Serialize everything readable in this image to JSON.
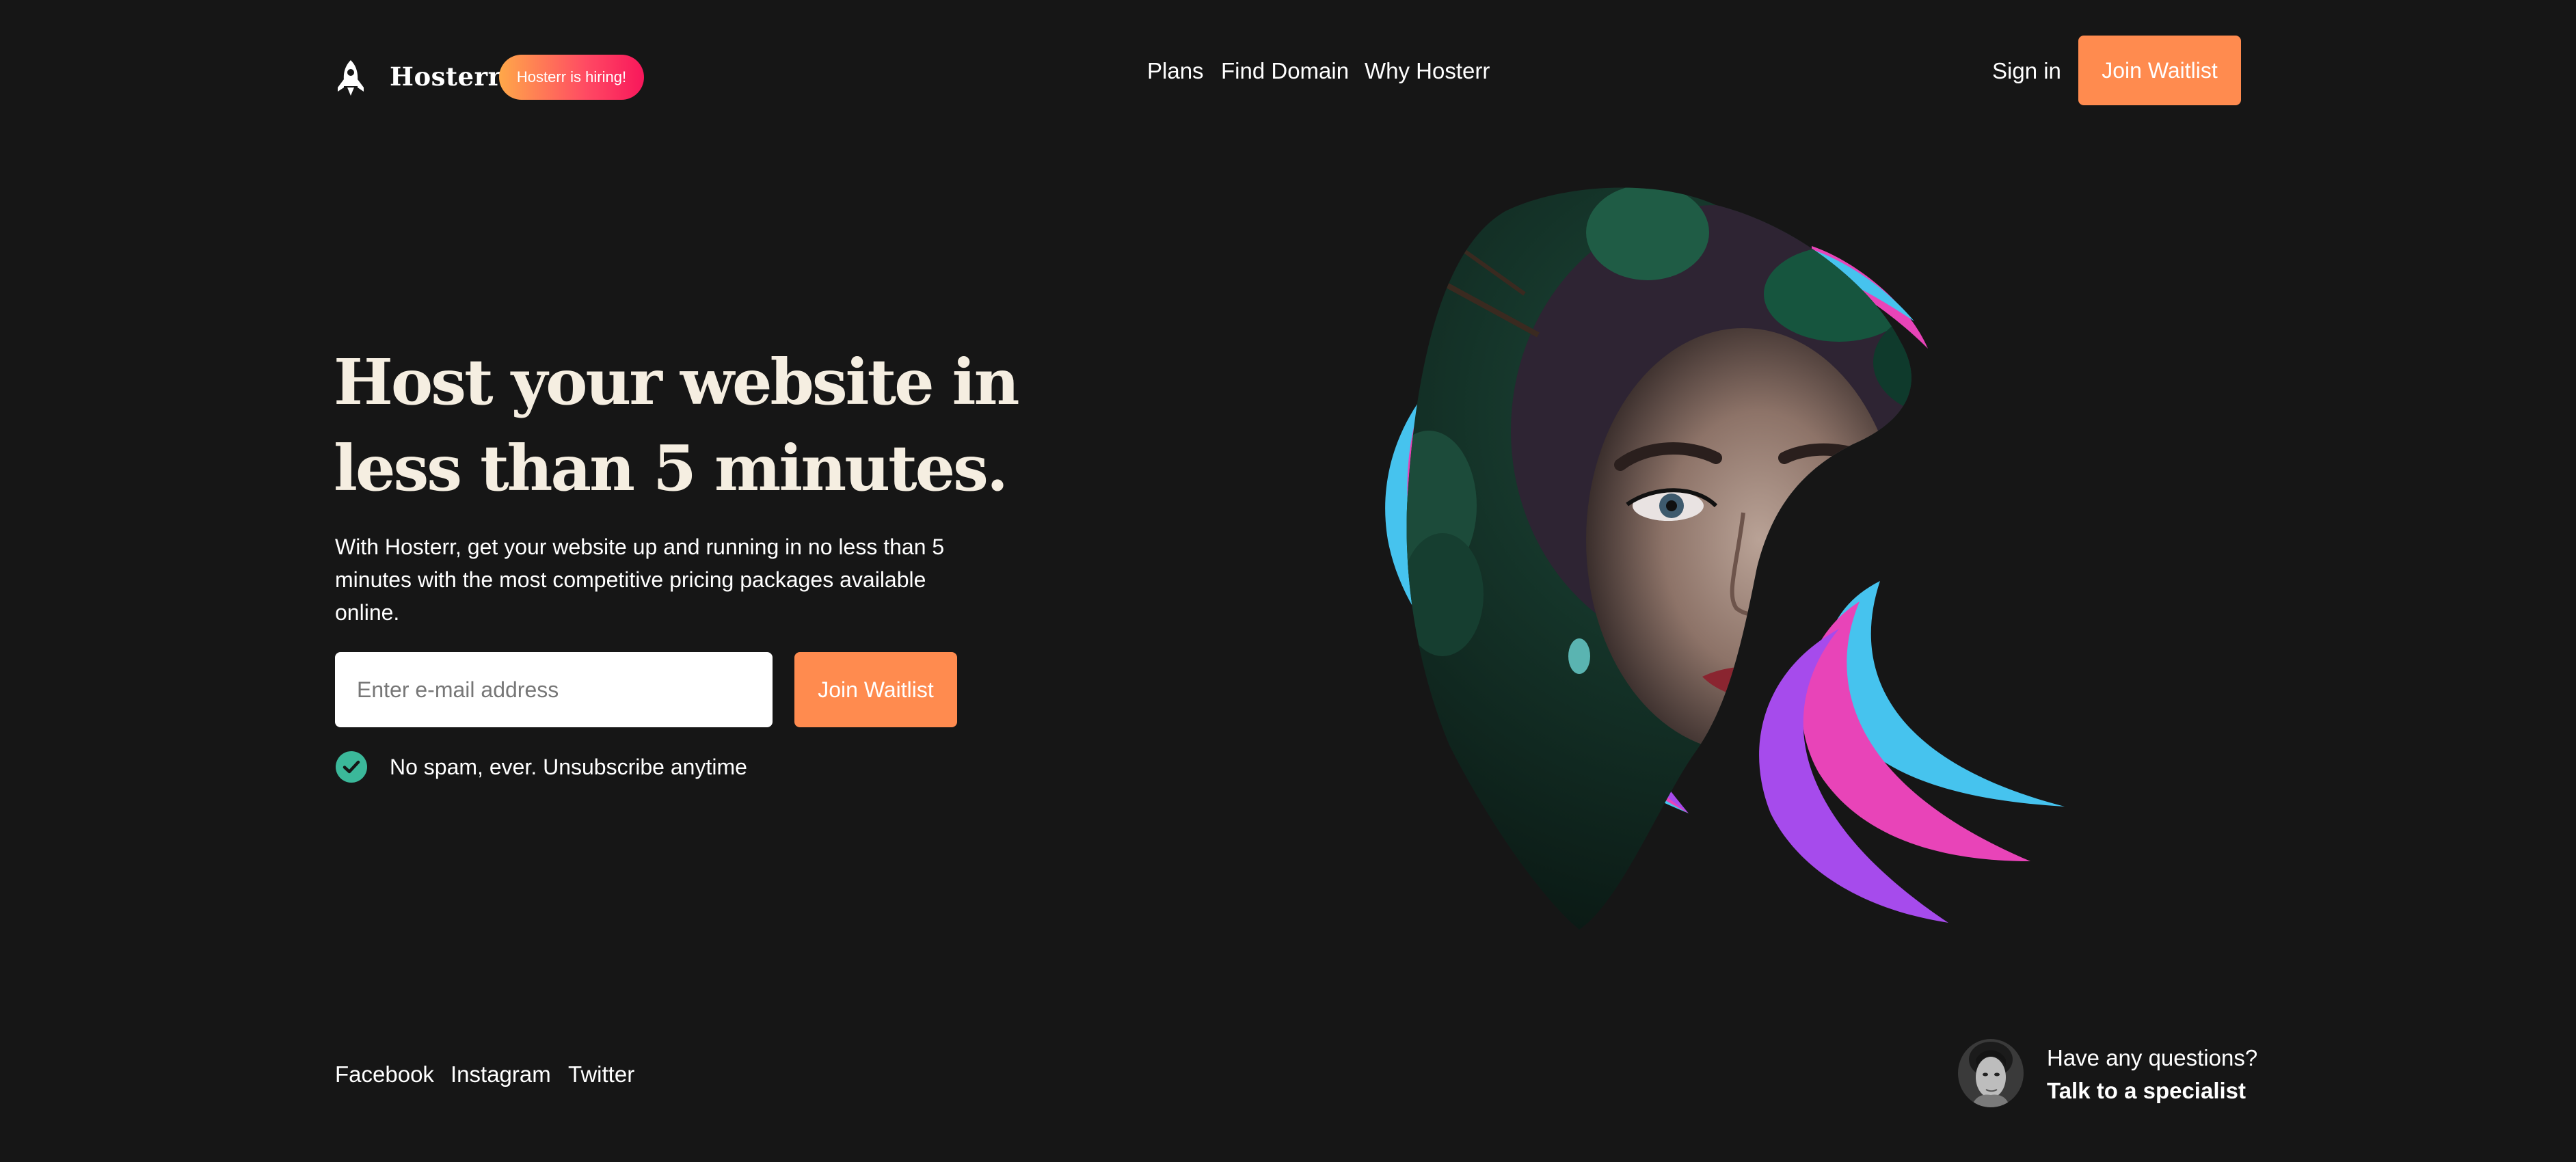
{
  "colors": {
    "background": "#161616",
    "accent_orange": "#ff8b4f",
    "heading_cream": "#f5eee1",
    "check_green": "#3bb89a",
    "hiring_gradient_start": "#ffa849",
    "hiring_gradient_end": "#f8175b",
    "ribbon_purple": "#a64bec",
    "ribbon_pink": "#e844b8",
    "ribbon_blue": "#46c3ee"
  },
  "header": {
    "logo_icon": "rocket-icon",
    "brand": "Hosterr",
    "hiring_badge": "Hosterr is hiring!",
    "nav": [
      {
        "label": "Plans"
      },
      {
        "label": "Find Domain"
      },
      {
        "label": "Why Hosterr"
      }
    ],
    "sign_in": "Sign in",
    "join_waitlist": "Join Waitlist"
  },
  "hero": {
    "title": "Host your website in less than 5 minutes.",
    "subtitle": "With Hosterr, get your website up and running in no less than 5 minutes with the most competitive pricing packages available online.",
    "email_placeholder": "Enter e-mail address",
    "email_value": "",
    "join_waitlist": "Join Waitlist",
    "no_spam_icon": "check-circle-icon",
    "no_spam": "No spam, ever. Unsubscribe anytime",
    "art_description_icon": "portrait-blob-image"
  },
  "footer": {
    "social": [
      {
        "label": "Facebook"
      },
      {
        "label": "Instagram"
      },
      {
        "label": "Twitter"
      }
    ],
    "avatar_icon": "specialist-avatar",
    "questions": "Have any questions?",
    "talk": "Talk to a specialist"
  }
}
